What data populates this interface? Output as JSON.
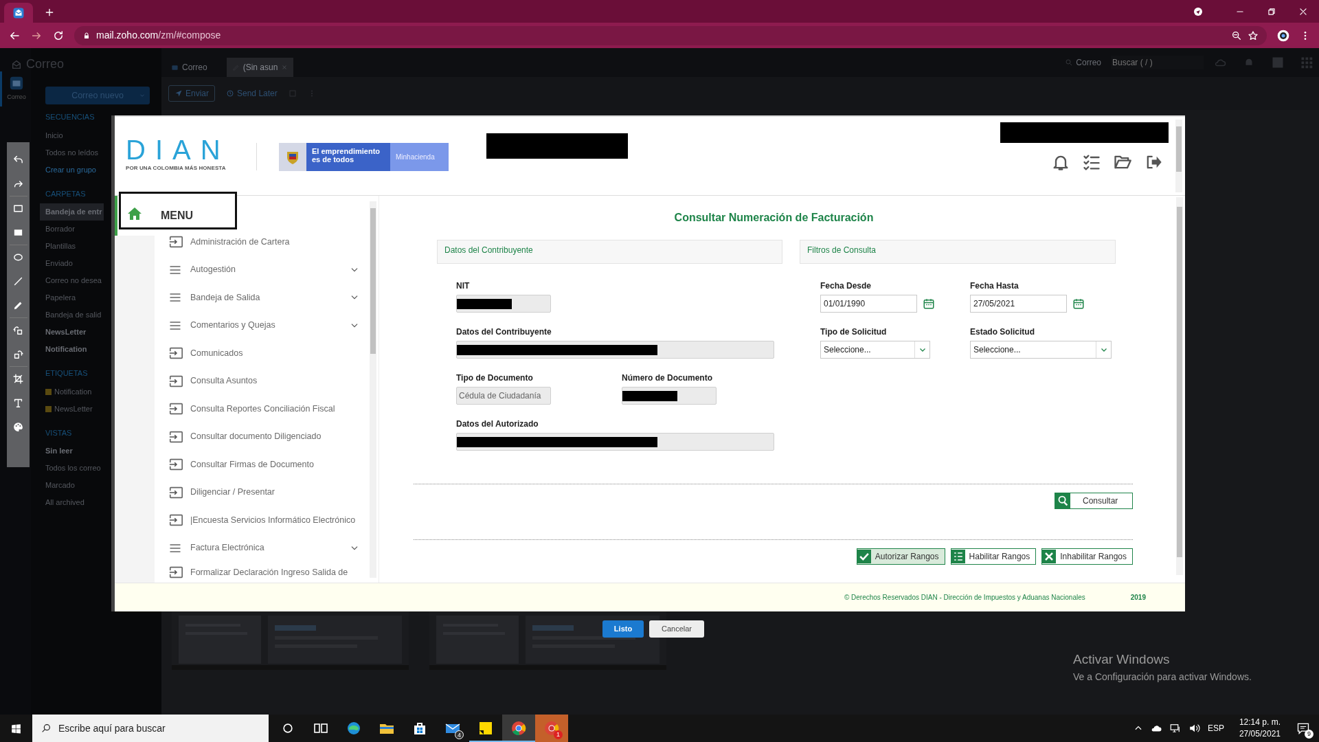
{
  "browser": {
    "url_host": "mail.zoho.com",
    "url_path": "/zm/#compose"
  },
  "app": {
    "title": "Correo",
    "rail": [
      {
        "label": "Correo",
        "selected": true
      }
    ],
    "new_mail": "Correo nuevo",
    "tabs": [
      {
        "label": "Correo",
        "selected": false
      },
      {
        "label": "(Sin asun",
        "selected": true
      }
    ],
    "search": {
      "scope": "Correo",
      "placeholder": "Buscar ( / )"
    },
    "toolbar": {
      "send": "Enviar",
      "send_later": "Send Later"
    },
    "sections": [
      {
        "title": "SECUENCIAS",
        "items": [
          {
            "label": "Inicio",
            "bold": false,
            "selected": false,
            "kind": "text"
          },
          {
            "label": "Todos no leídos",
            "bold": false,
            "selected": false,
            "kind": "text"
          },
          {
            "label": "Crear un grupo",
            "bold": false,
            "selected": false,
            "kind": "link"
          }
        ]
      },
      {
        "title": "CARPETAS",
        "items": [
          {
            "label": "Bandeja de entr",
            "bold": true,
            "selected": true,
            "kind": "text"
          },
          {
            "label": "Borrador",
            "bold": false,
            "selected": false,
            "kind": "text"
          },
          {
            "label": "Plantillas",
            "bold": false,
            "selected": false,
            "kind": "text"
          },
          {
            "label": "Enviado",
            "bold": false,
            "selected": false,
            "kind": "text"
          },
          {
            "label": "Correo no desea",
            "bold": false,
            "selected": false,
            "kind": "text"
          },
          {
            "label": "Papelera",
            "bold": false,
            "selected": false,
            "kind": "text"
          },
          {
            "label": "Bandeja de salid",
            "bold": false,
            "selected": false,
            "kind": "text"
          },
          {
            "label": "NewsLetter",
            "bold": true,
            "selected": false,
            "kind": "text"
          },
          {
            "label": "Notification",
            "bold": true,
            "selected": false,
            "kind": "text"
          }
        ]
      },
      {
        "title": "ETIQUETAS",
        "items": [
          {
            "label": "Notification",
            "bold": false,
            "selected": false,
            "kind": "tag",
            "color": "#5a4a10"
          },
          {
            "label": "NewsLetter",
            "bold": false,
            "selected": false,
            "kind": "tag",
            "color": "#5a4a10"
          }
        ]
      },
      {
        "title": "VISTAS",
        "items": [
          {
            "label": "Sin leer",
            "bold": true,
            "selected": false,
            "kind": "text"
          },
          {
            "label": "Todos los correo",
            "bold": false,
            "selected": false,
            "kind": "text"
          },
          {
            "label": "Marcado",
            "bold": false,
            "selected": false,
            "kind": "text"
          },
          {
            "label": "All archived",
            "bold": false,
            "selected": false,
            "kind": "text"
          }
        ]
      }
    ]
  },
  "dian": {
    "logo": "DIAN",
    "tagline": "POR UNA COLOMBIA MÁS HONESTA",
    "gov_badge": {
      "slogan": "El emprendimiento es de todos",
      "ministry": "Minhacienda"
    },
    "menu": {
      "title": "MENU",
      "items": [
        {
          "label": "Administración de Cartera",
          "kind": "link"
        },
        {
          "label": "Autogestión",
          "kind": "group"
        },
        {
          "label": "Bandeja de Salida",
          "kind": "group"
        },
        {
          "label": "Comentarios y Quejas",
          "kind": "group"
        },
        {
          "label": "Comunicados",
          "kind": "link"
        },
        {
          "label": "Consulta Asuntos",
          "kind": "link"
        },
        {
          "label": "Consulta Reportes Conciliación Fiscal",
          "kind": "link"
        },
        {
          "label": "Consultar documento Diligenciado",
          "kind": "link"
        },
        {
          "label": "Consultar Firmas de Documento",
          "kind": "link"
        },
        {
          "label": "Diligenciar / Presentar",
          "kind": "link"
        },
        {
          "label": "|Encuesta Servicios Informático Electrónico",
          "kind": "link"
        },
        {
          "label": "Factura Electrónica",
          "kind": "group"
        },
        {
          "label": "Formalizar Declaración Ingreso Salida de",
          "kind": "link"
        }
      ]
    },
    "page_title": "Consultar Numeración de Facturación",
    "panels": [
      {
        "title": "Datos del Contribuyente"
      },
      {
        "title": "Filtros de Consulta"
      }
    ],
    "taxpayer_fields": [
      {
        "label": "NIT",
        "redacted": true,
        "kind": "short"
      },
      {
        "label": "Datos del Contribuyente",
        "redacted": true,
        "kind": "long"
      },
      {
        "label": "Tipo de Documento",
        "value": "Cédula de Ciudadanía",
        "redacted": false,
        "kind": "short"
      },
      {
        "label": "Número de Documento",
        "redacted": true,
        "kind": "short"
      },
      {
        "label": "Datos del Autorizado",
        "redacted": true,
        "kind": "long"
      }
    ],
    "filters": [
      {
        "label": "Fecha Desde",
        "value": "01/01/1990",
        "kind": "date"
      },
      {
        "label": "Fecha Hasta",
        "value": "27/05/2021",
        "kind": "date"
      },
      {
        "label": "Tipo de Solicitud",
        "value": "Seleccione...",
        "kind": "select"
      },
      {
        "label": "Estado Solicitud",
        "value": "Seleccione...",
        "kind": "select"
      }
    ],
    "search_button": "Consultar",
    "actions": [
      {
        "label": "Autorizar Rangos",
        "kind": "check",
        "highlighted": true
      },
      {
        "label": "Habilitar Rangos",
        "kind": "list",
        "highlighted": false
      },
      {
        "label": "Inhabilitar Rangos",
        "kind": "cross",
        "highlighted": false
      }
    ],
    "footer": {
      "copyright": "© Derechos Reservados DIAN - Dirección de Impuestos y Aduanas Nacionales",
      "year": "2019"
    }
  },
  "dialog_buttons": [
    {
      "label": "Listo",
      "primary": true
    },
    {
      "label": "Cancelar",
      "primary": false
    }
  ],
  "activation_notice": {
    "title": "Activar Windows",
    "text": "Ve a Configuración para activar Windows."
  },
  "taskbar": {
    "search_placeholder": "Escribe aquí para buscar",
    "apps": [
      {
        "kind": "cortana",
        "selected": false
      },
      {
        "kind": "taskview",
        "selected": false
      },
      {
        "kind": "edge",
        "selected": false
      },
      {
        "kind": "explorer",
        "selected": false
      },
      {
        "kind": "store",
        "selected": false
      },
      {
        "kind": "mail",
        "badge": "4",
        "selected": false
      },
      {
        "kind": "notes",
        "selected": false
      },
      {
        "kind": "chrome",
        "selected": true
      },
      {
        "kind": "chrome-alt",
        "badge": "1",
        "selected": false
      }
    ],
    "language": "ESP",
    "time": "12:14 p. m.",
    "date": "27/05/2021",
    "notifications": "9"
  }
}
